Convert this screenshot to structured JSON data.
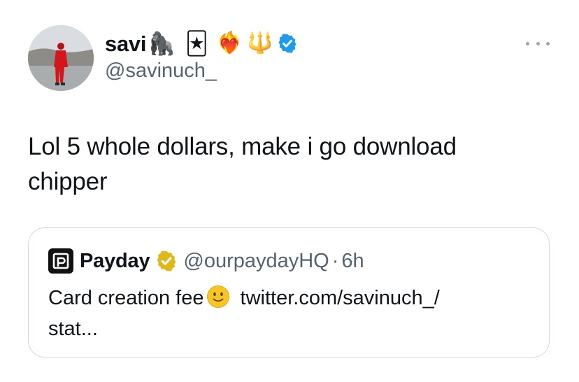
{
  "tweet": {
    "author": {
      "display_name": "savi",
      "name_emojis": [
        "🦍",
        "🃏",
        "❤️‍🔥",
        "🔱"
      ],
      "handle": "@savinuch_",
      "verified_icon": "verified-badge-icon",
      "avatar_icon": "avatar-photo"
    },
    "more_icon": "more-options-icon",
    "text_line1": "Lol 5 whole dollars, make i go download",
    "text_line2": "chipper",
    "quote": {
      "logo_icon": "payday-logo-icon",
      "name": "Payday",
      "badge_icon": "gold-verified-badge-icon",
      "handle": "@ourpaydayHQ",
      "separator": "·",
      "time": "6h",
      "text_before": "Card creation fee",
      "text_after": " twitter.com/savinuch_/",
      "text_line2": "stat...",
      "smiley_icon": "slightly-smiling-face-icon"
    }
  },
  "colors": {
    "text": "#0f1419",
    "secondary": "#536471",
    "verified_blue": "#1d9bf0",
    "gold": "#e2b719",
    "border": "#cfd9de"
  }
}
